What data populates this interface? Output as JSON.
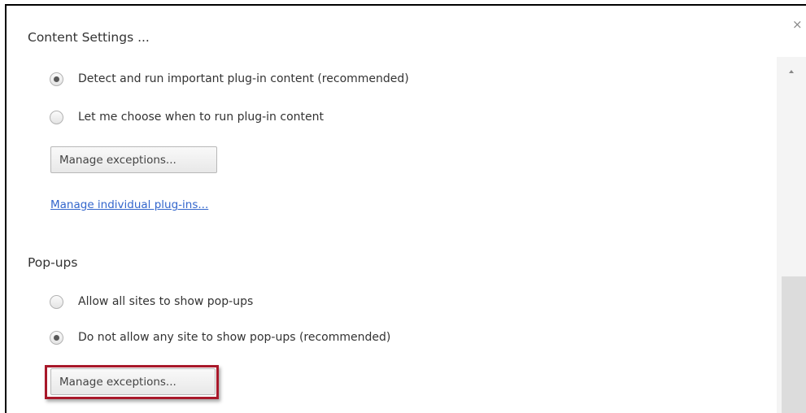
{
  "dialog": {
    "title": "Content Settings ...",
    "close_label": "×"
  },
  "plugins": {
    "options": [
      {
        "label": "Detect and run important plug-in content (recommended)",
        "checked": true
      },
      {
        "label": "Let me choose when to run plug-in content",
        "checked": false
      }
    ],
    "manage_exceptions_label": "Manage exceptions...",
    "manage_plugins_link": "Manage individual plug-ins..."
  },
  "popups": {
    "title": "Pop-ups",
    "options": [
      {
        "label": "Allow all sites to show pop-ups",
        "checked": false
      },
      {
        "label": "Do not allow any site to show pop-ups (recommended)",
        "checked": true
      }
    ],
    "manage_exceptions_label": "Manage exceptions..."
  },
  "colors": {
    "link": "#3366cc",
    "highlight": "#a8182a"
  }
}
